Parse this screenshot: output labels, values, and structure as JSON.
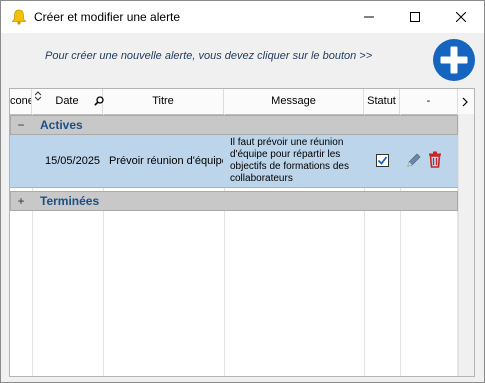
{
  "window": {
    "title": "Créer et modifier une alerte"
  },
  "hint": "Pour créer une nouvelle alerte, vous devez cliquer sur le bouton >>",
  "icons": {
    "app": "bell-icon",
    "add": "plus-circle-icon",
    "search": "search-icon",
    "edit": "pencil-icon",
    "delete": "trash-icon",
    "sort": "sort-arrows-icon",
    "scroll_right": "chevron-right-icon"
  },
  "colors": {
    "accent": "#1565c0",
    "group_text": "#1d4f86",
    "selected_row": "#bcd5ea",
    "delete": "#c62828",
    "group_bg": "#c8c8c8"
  },
  "grid": {
    "headers": {
      "icone": "cone",
      "date": "Date",
      "titre": "Titre",
      "message": "Message",
      "statut": "Statut",
      "actions": "-"
    },
    "groups": [
      {
        "toggle": "−",
        "label": "Actives"
      },
      {
        "toggle": "+",
        "label": "Terminées"
      }
    ],
    "rows": [
      {
        "date": "15/05/2025",
        "titre": "Prévoir réunion d'équipe",
        "message": "Il faut prévoir une réunion d'équipe pour répartir les objectifs de formations des collaborateurs",
        "statut_checked": true
      }
    ]
  }
}
